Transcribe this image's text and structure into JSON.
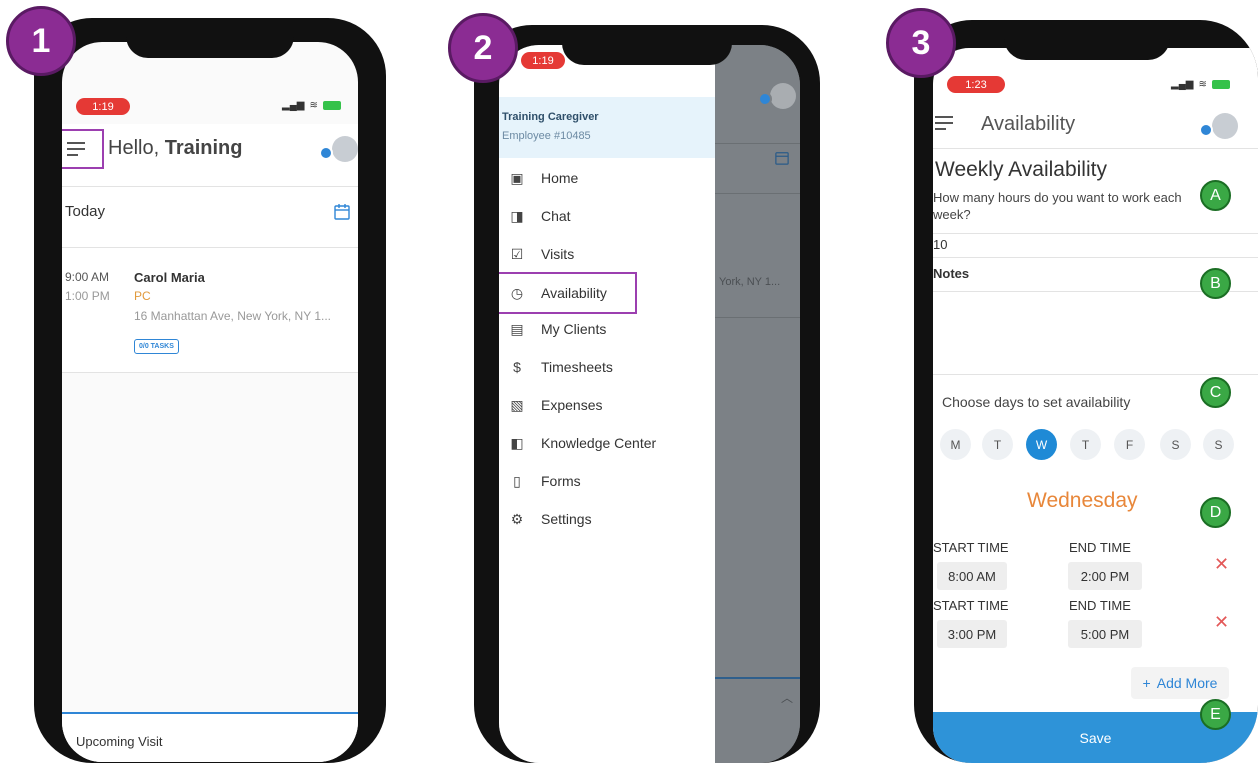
{
  "steps": [
    "1",
    "2",
    "3"
  ],
  "screen1": {
    "time": "1:19",
    "greeting": "Hello,",
    "user_name": "Training",
    "section_title": "Today",
    "visit": {
      "start": "9:00 AM",
      "end": "1:00 PM",
      "client": "Carol Maria",
      "service": "PC",
      "address": "16 Manhattan Ave, New York, NY 1...",
      "tasks": "0/0 TASKS"
    },
    "upcoming": "Upcoming Visit"
  },
  "screen2": {
    "time": "1:19",
    "caregiver_name": "Training Caregiver",
    "employee_id": "Employee #10485",
    "menu": [
      {
        "label": "Home",
        "icon": "calendar-icon"
      },
      {
        "label": "Chat",
        "icon": "chat-icon"
      },
      {
        "label": "Visits",
        "icon": "visits-icon"
      },
      {
        "label": "Availability",
        "icon": "clock-icon"
      },
      {
        "label": "My Clients",
        "icon": "clients-icon"
      },
      {
        "label": "Timesheets",
        "icon": "dollar-icon"
      },
      {
        "label": "Expenses",
        "icon": "expenses-icon"
      },
      {
        "label": "Knowledge Center",
        "icon": "book-icon"
      },
      {
        "label": "Forms",
        "icon": "clipboard-icon"
      },
      {
        "label": "Settings",
        "icon": "gear-icon"
      }
    ],
    "background_address": "York, NY 1..."
  },
  "screen3": {
    "time": "1:23",
    "header_title": "Availability",
    "section_title": "Weekly Availability",
    "question": "How many hours do you want to work each week?",
    "hours_value": "10",
    "notes_label": "Notes",
    "choose_days": "Choose days to set availability",
    "days": [
      "M",
      "T",
      "W",
      "T",
      "F",
      "S",
      "S"
    ],
    "active_day_index": 2,
    "selected_day": "Wednesday",
    "start_label": "START TIME",
    "end_label": "END TIME",
    "slots": [
      {
        "start": "8:00 AM",
        "end": "2:00 PM"
      },
      {
        "start": "3:00 PM",
        "end": "5:00 PM"
      }
    ],
    "add_more": "Add More",
    "save": "Save",
    "badges": [
      "A",
      "B",
      "C",
      "D",
      "E"
    ]
  },
  "colors": {
    "step_purple": "#8b2c93",
    "highlight_purple": "#9c3fb0",
    "accent_blue": "#1f8ad6",
    "service_orange": "#e19a3c",
    "wednesday_orange": "#e8873a",
    "badge_green": "#3aa845",
    "status_red": "#e53935"
  }
}
